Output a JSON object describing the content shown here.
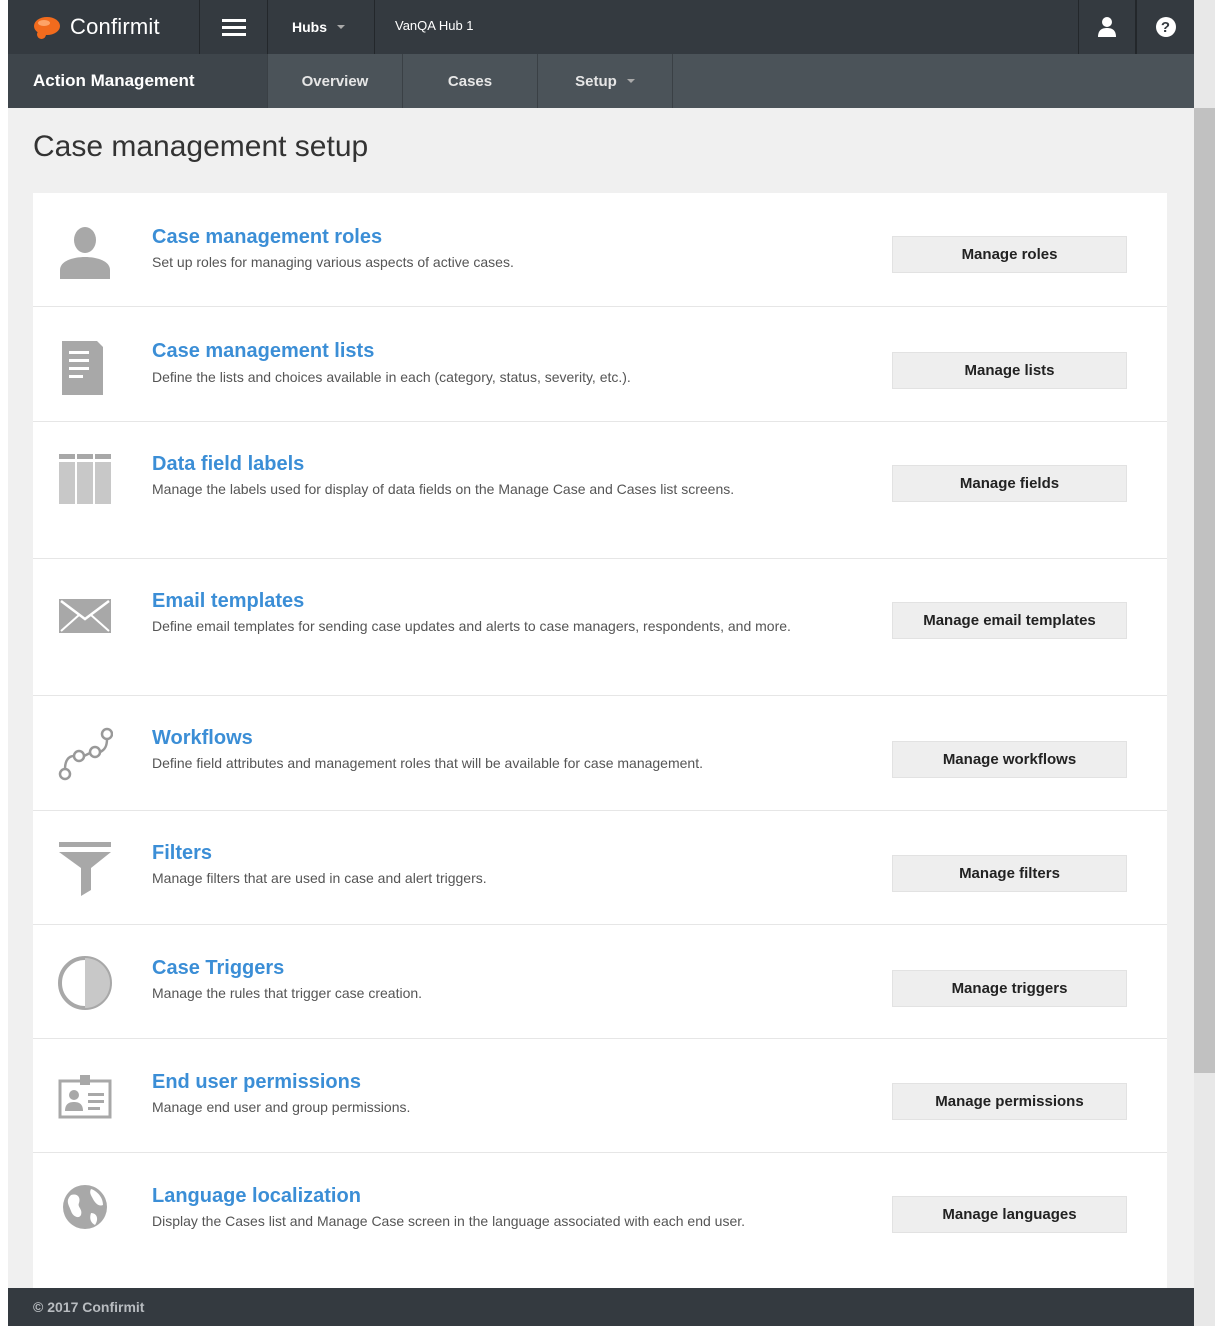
{
  "topbar": {
    "brand": "Confirmit",
    "hubs_label": "Hubs",
    "hub_name": "VanQA Hub 1",
    "user_icon": "user-icon",
    "help_icon": "help-icon",
    "help_glyph": "?"
  },
  "subnav": {
    "title": "Action Management",
    "items": [
      {
        "label": "Overview"
      },
      {
        "label": "Cases"
      },
      {
        "label": "Setup"
      }
    ]
  },
  "page": {
    "title": "Case management setup"
  },
  "sections": [
    {
      "heading": "Case management roles",
      "description": "Set up roles for managing various aspects of active cases.",
      "button": "Manage roles",
      "icon": "person-icon"
    },
    {
      "heading": "Case management lists",
      "description": "Define the lists and choices available in each (category, status, severity, etc.).",
      "button": "Manage lists",
      "icon": "document-icon"
    },
    {
      "heading": "Data field labels",
      "description": "Manage the labels used for display of data fields on the Manage Case and Cases list screens.",
      "button": "Manage fields",
      "icon": "columns-icon"
    },
    {
      "heading": "Email templates",
      "description": "Define email templates for sending case updates and alerts to case managers, respondents, and more.",
      "button": "Manage email templates",
      "icon": "envelope-icon"
    },
    {
      "heading": "Workflows",
      "description": "Define field attributes and management roles that will be available for case management.",
      "button": "Manage workflows",
      "icon": "workflow-icon"
    },
    {
      "heading": "Filters",
      "description": "Manage filters that are used in case and alert triggers.",
      "button": "Manage filters",
      "icon": "funnel-icon"
    },
    {
      "heading": "Case Triggers",
      "description": "Manage the rules that trigger case creation.",
      "button": "Manage triggers",
      "icon": "half-circle-icon"
    },
    {
      "heading": "End user permissions",
      "description": "Manage end user and group permissions.",
      "button": "Manage permissions",
      "icon": "id-badge-icon"
    },
    {
      "heading": "Language localization",
      "description": "Display the Cases list and Manage Case screen in the language associated with each end user.",
      "button": "Manage languages",
      "icon": "globe-icon"
    }
  ],
  "footer": {
    "text": "© 2017 Confirmit"
  },
  "colors": {
    "topbar": "#343a40",
    "subnav": "#4b5359",
    "link": "#3b8ed6",
    "brand_orange": "#f26b1d"
  }
}
